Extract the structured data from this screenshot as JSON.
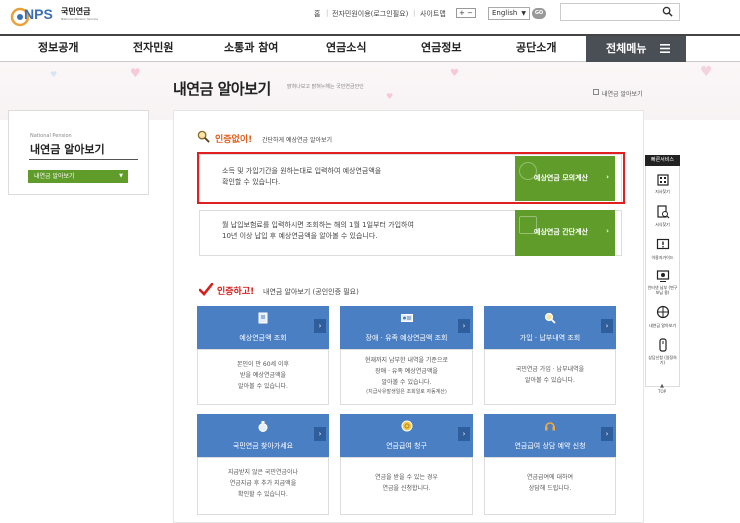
{
  "header": {
    "logo_text": "NPS",
    "logo_korean": "국민연금",
    "logo_sub": "National Pension Service",
    "util_links": [
      "홈",
      "전자민원이용(로그인필요)",
      "사이트맵"
    ],
    "font_size_control": "+ −",
    "language_select": "English",
    "go_button": "GO",
    "search_placeholder": ""
  },
  "nav": {
    "items": [
      "정보공개",
      "전자민원",
      "소통과 참여",
      "연금소식",
      "연금정보",
      "공단소개"
    ],
    "all_menu": "전체메뉴"
  },
  "page": {
    "title": "내연금 알아보기",
    "subtitle": "밝혀나보고 밝혀누해는 국민연금안인",
    "breadcrumb": "내연금 알아보기"
  },
  "sidebar": {
    "english": "National Pension",
    "title": "내연금 알아보기",
    "dropdown": "내연금 알아보기"
  },
  "section1": {
    "label": "인증없이!",
    "desc": "간단하게 예상연금 알아보기",
    "card1_text": [
      "소득 및 가입기간을 원하는대로 입력하여 예상연금액을",
      "확인할 수 있습니다."
    ],
    "card1_button": "예상연금 모의계산",
    "card2_text": [
      "월 납입보험료를 입력하시면 조회하는 해의 1월 1일부터 가입하여",
      "10년 이상 납입 후 예상연금액을 알아볼 수 있습니다."
    ],
    "card2_button": "예상연금 간단계산"
  },
  "section2": {
    "label": "인증하고!",
    "desc": "내연금 알아보기 (공인인증 필요)",
    "tiles": [
      {
        "title": "예상연금액 조회",
        "icon": "document-icon",
        "lines": [
          "본인이 만 60세 이후",
          "받을 예상연금액을",
          "알아볼 수 있습니다."
        ],
        "note": ""
      },
      {
        "title": "장애 · 유족 예상연금액 조회",
        "icon": "id-card-icon",
        "lines": [
          "현재까지 납부한 내역을 기준으로",
          "장애 · 유족 예상연금액을",
          "알아볼 수 있습니다."
        ],
        "note": "(지급사유발생일은 조회일로 자동계산)"
      },
      {
        "title": "가입 · 납부내역 조회",
        "icon": "magnifier-icon",
        "lines": [
          "국민연금 가입 · 납부내역을",
          "알아볼 수 있습니다."
        ],
        "note": ""
      },
      {
        "title": "국민연금 찾아가세요",
        "icon": "money-bag-icon",
        "lines": [
          "지급받지 않은 국민연금이나",
          "연금지급 후 추가 지급액을",
          "확인할 수 있습니다."
        ],
        "note": ""
      },
      {
        "title": "연금급여 청구",
        "icon": "coin-icon",
        "lines": [
          "연금을 받을 수 있는 경우",
          "연금을 신청합니다."
        ],
        "note": ""
      },
      {
        "title": "연금급여 상담 예약 신청",
        "icon": "headset-icon",
        "lines": [
          "연금급여에 대하여",
          "상담해 드립니다."
        ],
        "note": ""
      }
    ]
  },
  "quick_service": {
    "title": "빠른서비스",
    "items": [
      {
        "label": "지사찾기",
        "icon": "building-icon"
      },
      {
        "label": "서식찾기",
        "icon": "form-search-icon"
      },
      {
        "label": "이용자가이드",
        "icon": "guide-icon"
      },
      {
        "label": "인터넷 납부 (변구보님 용)",
        "icon": "payment-icon"
      },
      {
        "label": "내연금 알아보기",
        "icon": "pension-icon"
      },
      {
        "label": "상담신청 (일정하기)",
        "icon": "consult-icon"
      }
    ],
    "top": "TOP"
  },
  "colors": {
    "green": "#5f9c2a",
    "blue": "#4a7fc3",
    "highlight_red": "#e02020",
    "nav_dark": "#4a4f55"
  }
}
